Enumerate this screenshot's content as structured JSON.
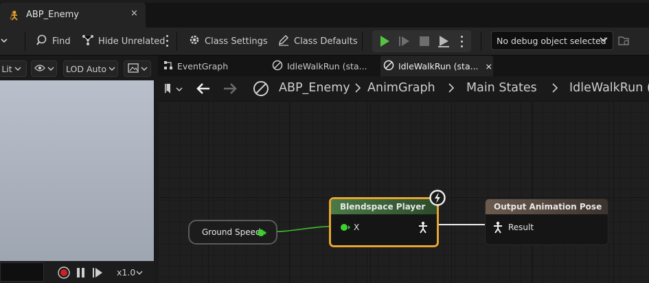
{
  "window": {
    "tab_title": "ABP_Enemy",
    "close_glyph": "×"
  },
  "toolbar": {
    "find_label": "Find",
    "hide_unrelated_label": "Hide Unrelated",
    "class_settings_label": "Class Settings",
    "class_defaults_label": "Class Defaults",
    "debug_select_value": "No debug object selected",
    "accent_play_color": "#55c441"
  },
  "viewport": {
    "lit_label": "Lit",
    "lod_label": "LOD Auto",
    "playback_speed": "x1.0"
  },
  "graph_tabs": [
    {
      "label": "EventGraph"
    },
    {
      "label": "IdleWalkRun (sta..."
    },
    {
      "label": "IdleWalkRun (sta...",
      "active": true,
      "close_glyph": "×"
    }
  ],
  "breadcrumb": [
    "ABP_Enemy",
    "AnimGraph",
    "Main States",
    "IdleWalkRun ("
  ],
  "nodes": {
    "ground_speed": {
      "label": "Ground Speed"
    },
    "blendspace": {
      "title": "Blendspace Player",
      "pin_x": "X",
      "highlight_color": "#e8a631"
    },
    "output_pose": {
      "title": "Output Animation Pose",
      "pin_result": "Result"
    }
  }
}
